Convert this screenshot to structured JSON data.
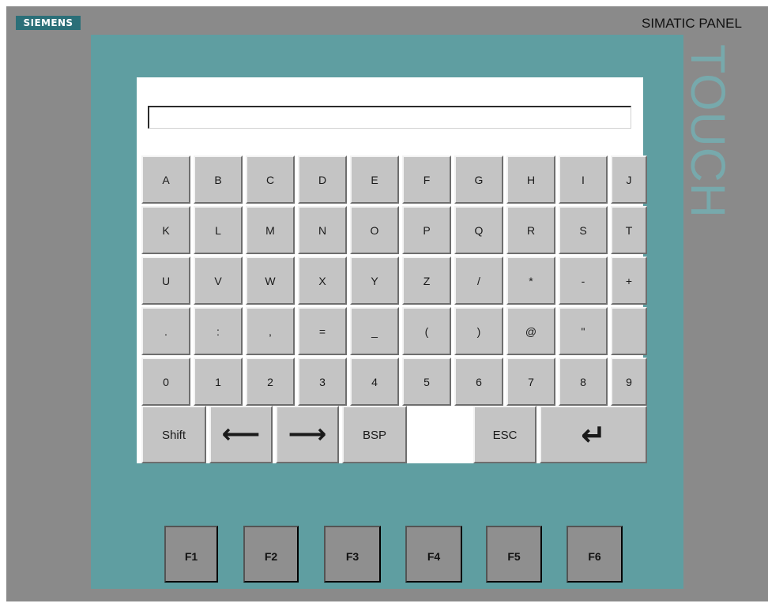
{
  "brand": "SIEMENS",
  "model": "SIMATIC PANEL",
  "panel_series": "TOUCH",
  "entry": {
    "value": "",
    "placeholder": ""
  },
  "keys": {
    "row1": [
      "A",
      "B",
      "C",
      "D",
      "E",
      "F",
      "G",
      "H",
      "I",
      "J"
    ],
    "row2": [
      "K",
      "L",
      "M",
      "N",
      "O",
      "P",
      "Q",
      "R",
      "S",
      "T"
    ],
    "row3": [
      "U",
      "V",
      "W",
      "X",
      "Y",
      "Z",
      "/",
      "*",
      "-",
      "+"
    ],
    "row4": [
      ".",
      ":",
      ",",
      "=",
      "_",
      "(",
      ")",
      "@",
      "\"",
      ""
    ],
    "row5": [
      "0",
      "1",
      "2",
      "3",
      "4",
      "5",
      "6",
      "7",
      "8",
      "9"
    ],
    "bottom": {
      "shift": "Shift",
      "left": "⟵",
      "right": "⟶",
      "backspace": "BSP",
      "escape": "ESC",
      "enter": "↵"
    }
  },
  "function_keys": [
    "F1",
    "F2",
    "F3",
    "F4",
    "F5",
    "F6"
  ],
  "colors": {
    "frame": "#8a8a8a",
    "panel": "#5f9ea1",
    "brand_badge": "#2b6f78",
    "key_face": "#c4c4c4",
    "function_key": "#8f8f8f",
    "keyboard_background": "#ffffff"
  },
  "icons": {
    "left": "left-arrow-icon",
    "right": "right-arrow-icon",
    "enter": "enter-icon"
  }
}
